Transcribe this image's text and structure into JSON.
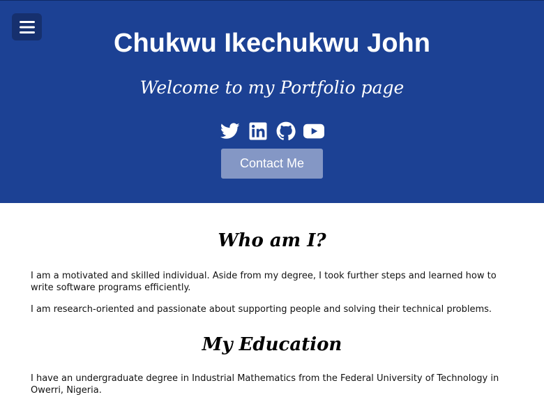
{
  "header": {
    "menu_icon": "hamburger-menu-icon",
    "title": "Chukwu Ikechukwu John",
    "subtitle": "Welcome to my Portfolio page",
    "socials": [
      {
        "icon": "twitter-icon"
      },
      {
        "icon": "linkedin-icon"
      },
      {
        "icon": "github-icon"
      },
      {
        "icon": "youtube-icon"
      }
    ],
    "contact_label": "Contact Me"
  },
  "about": {
    "heading": "Who am I?",
    "paragraphs": [
      "I am a motivated and skilled individual. Aside from my degree, I took further steps and learned how to write software programs efficiently.",
      "I am research-oriented and passionate about supporting people and solving their technical problems."
    ]
  },
  "education": {
    "heading": "My Education",
    "paragraphs": [
      "I have an undergraduate degree in Industrial Mathematics from the Federal University of Technology in Owerri, Nigeria."
    ]
  },
  "colors": {
    "header_bg": "#1c4194",
    "menu_bg": "#16306e",
    "contact_bg": "#8497c5",
    "text": "#111111",
    "page_bg": "#ffffff"
  }
}
